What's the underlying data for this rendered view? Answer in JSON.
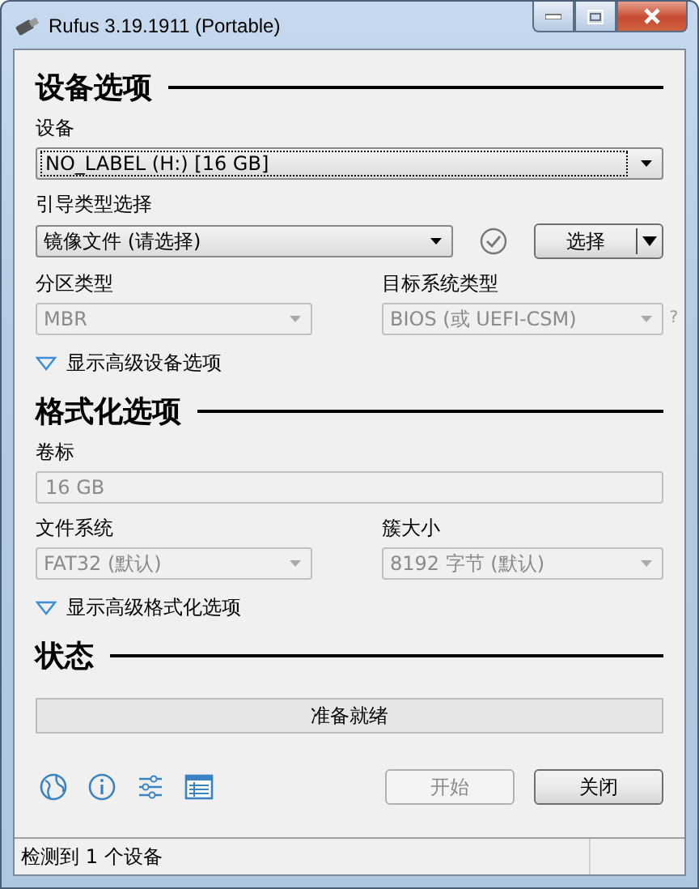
{
  "window": {
    "title": "Rufus 3.19.1911 (Portable)"
  },
  "device_options": {
    "heading": "设备选项",
    "device": {
      "label": "设备",
      "value": "NO_LABEL (H:) [16 GB]",
      "disabled": false
    },
    "boot_selection": {
      "label": "引导类型选择",
      "value": "镜像文件 (请选择)",
      "disabled": false
    },
    "select_button": {
      "label": "选择"
    },
    "partition_scheme": {
      "label": "分区类型",
      "value": "MBR",
      "disabled": true
    },
    "target_system": {
      "label": "目标系统类型",
      "value": "BIOS (或 UEFI-CSM)",
      "disabled": true
    },
    "help_mark": "?",
    "advanced_toggle": {
      "label": "显示高级设备选项",
      "expanded": false
    }
  },
  "format_options": {
    "heading": "格式化选项",
    "volume_label": {
      "label": "卷标",
      "value": "16 GB",
      "disabled": true
    },
    "file_system": {
      "label": "文件系统",
      "value": "FAT32 (默认)",
      "disabled": true
    },
    "cluster_size": {
      "label": "簇大小",
      "value": "8192 字节 (默认)",
      "disabled": true
    },
    "advanced_toggle": {
      "label": "显示高级格式化选项",
      "expanded": false
    }
  },
  "status": {
    "heading": "状态",
    "text": "准备就绪"
  },
  "buttons": [
    {
      "label": "开始",
      "disabled": true
    },
    {
      "label": "关闭",
      "disabled": false
    }
  ],
  "status_bar": {
    "text": "检测到 1 个设备"
  }
}
